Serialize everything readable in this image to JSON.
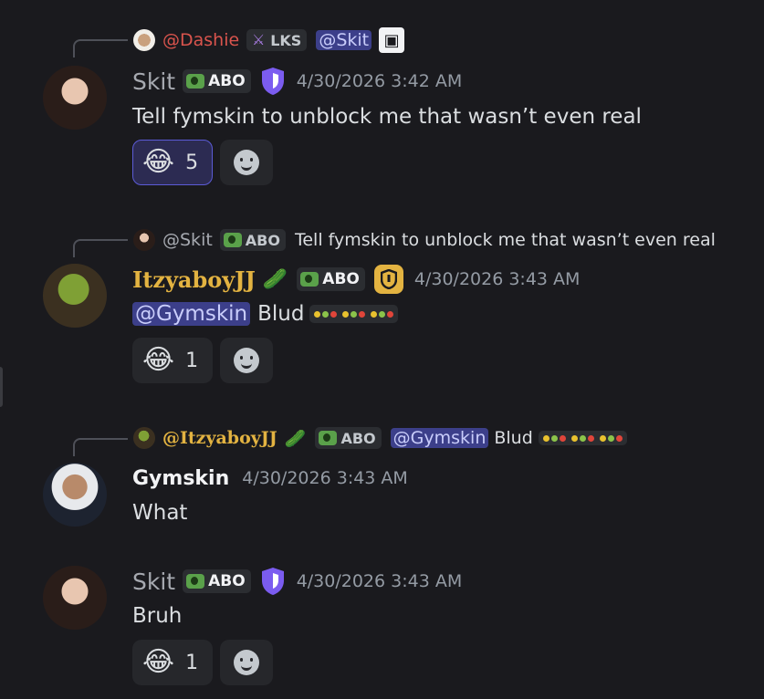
{
  "messages": [
    {
      "reply": {
        "author": "@Dashie",
        "tag": "LKS",
        "mention": "@Skit"
      },
      "author": "Skit",
      "tag": "ABO",
      "timestamp": "4/30/2026 3:42 AM",
      "content": "Tell fymskin to unblock me that wasn’t even real",
      "reaction": {
        "emoji": "😂",
        "count": "5"
      }
    },
    {
      "reply": {
        "author": "@Skit",
        "tag": "ABO",
        "text": "Tell fymskin to unblock me that wasn’t even real"
      },
      "author": "ItzyaboyJJ",
      "tag": "ABO",
      "timestamp": "4/30/2026 3:43 AM",
      "mention": "@Gymskin",
      "content": "Blud",
      "reaction": {
        "emoji": "😂",
        "count": "1"
      }
    },
    {
      "reply": {
        "author": "@ItzyaboyJJ",
        "tag": "ABO",
        "mention": "@Gymskin",
        "text": "Blud"
      },
      "author": "Gymskin",
      "timestamp": "4/30/2026 3:43 AM",
      "content": "What"
    },
    {
      "author": "Skit",
      "tag": "ABO",
      "timestamp": "4/30/2026 3:43 AM",
      "content": "Bruh",
      "reaction": {
        "emoji": "😂",
        "count": "1"
      }
    }
  ],
  "icons": {
    "pickle": "🥒",
    "shield_color": "#7b5cf0",
    "gold_shield_color": "#e3b341",
    "reply_color_dashie": "#d9544d",
    "reply_color_jj": "#e3b341"
  }
}
